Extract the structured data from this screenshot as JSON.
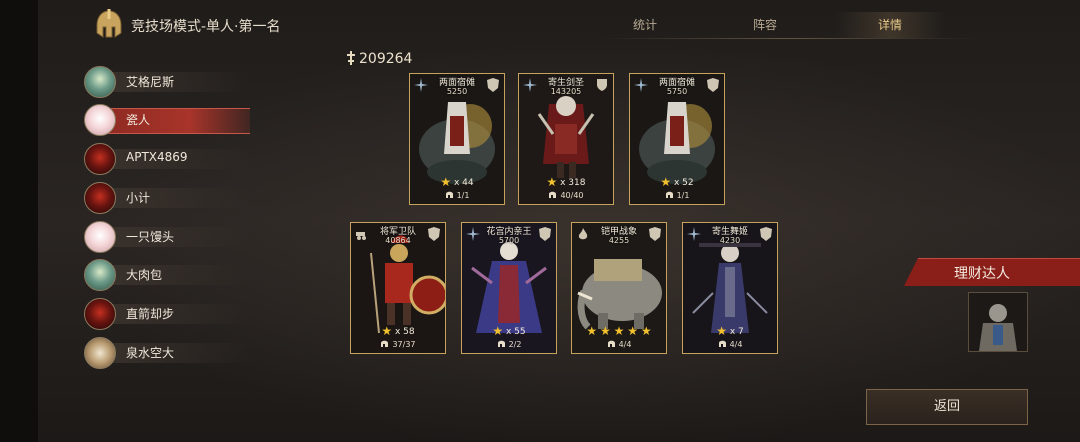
{
  "header": {
    "mode_title": "竞技场模式-单人·第一名",
    "tabs": [
      {
        "label": "统计",
        "active": false
      },
      {
        "label": "阵容",
        "active": false
      },
      {
        "label": "详情",
        "active": true
      }
    ]
  },
  "players": [
    {
      "name": "艾格尼斯",
      "avatar": "green-haired-portrait",
      "selected": false
    },
    {
      "name": "瓷人",
      "avatar": "white-porcelain-portrait",
      "selected": true
    },
    {
      "name": "APTX4869",
      "avatar": "red-demon-helm",
      "selected": false
    },
    {
      "name": "小计",
      "avatar": "red-demon-helm",
      "selected": false
    },
    {
      "name": "一只馒头",
      "avatar": "white-porcelain-portrait",
      "selected": false
    },
    {
      "name": "大肉包",
      "avatar": "green-haired-portrait",
      "selected": false
    },
    {
      "name": "直箭却步",
      "avatar": "red-demon-helm",
      "selected": false
    },
    {
      "name": "泉水空大",
      "avatar": "horned-warrior-portrait",
      "selected": false
    }
  ],
  "lineup": {
    "total_power": "209264",
    "cards": [
      {
        "name": "两面宿傩",
        "power": "5250",
        "stars_text": "x 44",
        "troops": "1/1",
        "type_icon": "compass-star-icon",
        "badge_icon": "beast-crest-icon",
        "art": "armored-rider-on-beast"
      },
      {
        "name": "寄生剑圣",
        "power": "143205",
        "stars_text": "x 318",
        "troops": "40/40",
        "type_icon": "compass-star-icon",
        "badge_icon": "shield-crest-icon",
        "art": "samurai-warrior"
      },
      {
        "name": "两面宿傩",
        "power": "5750",
        "stars_text": "x 52",
        "troops": "1/1",
        "type_icon": "compass-star-icon",
        "badge_icon": "beast-crest-icon",
        "art": "armored-rider-on-beast"
      },
      {
        "name": "将军卫队",
        "power": "40864",
        "stars_text": "x 58",
        "troops": "37/37",
        "type_icon": "cannon-icon",
        "badge_icon": "beast-crest-icon",
        "art": "roman-legionary"
      },
      {
        "name": "花宫内亲王",
        "power": "5700",
        "stars_text": "x 55",
        "troops": "2/2",
        "type_icon": "compass-star-icon",
        "badge_icon": "beast-crest-icon",
        "art": "robed-priestess"
      },
      {
        "name": "铠甲战象",
        "power": "4255",
        "stars_text": "",
        "star_count": 5,
        "troops": "4/4",
        "type_icon": "flame-icon",
        "badge_icon": "beast-crest-icon",
        "art": "armored-war-elephant"
      },
      {
        "name": "寄生舞姬",
        "power": "4230",
        "stars_text": "x 7",
        "troops": "4/4",
        "type_icon": "compass-star-icon",
        "badge_icon": "beast-crest-icon",
        "art": "dark-dancer"
      }
    ]
  },
  "side": {
    "tag_label": "理财达人",
    "avatar": "armored-knight-portrait"
  },
  "buttons": {
    "return_label": "返回"
  },
  "colors": {
    "gold_border": "#c5a35c",
    "selected_red": "#a8342a",
    "star_gold": "#f3c12e"
  }
}
